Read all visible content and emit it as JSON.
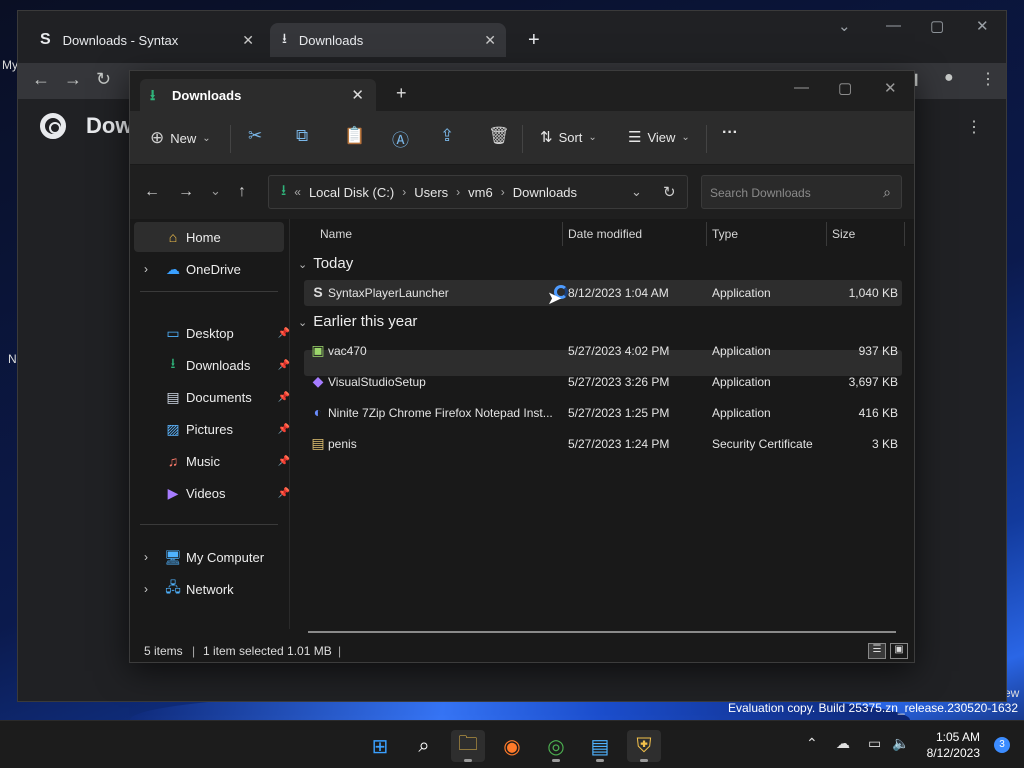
{
  "chrome": {
    "tabs": [
      {
        "label": "Downloads - Syntax",
        "icon_letter": "S"
      },
      {
        "label": "Downloads"
      }
    ],
    "page_title": "Dow",
    "left_fragment_my": "My",
    "left_fragment_n": "N"
  },
  "explorer": {
    "tab_title": "Downloads",
    "commands": {
      "new": "New",
      "sort": "Sort",
      "view": "View",
      "more": "···"
    },
    "breadcrumb": [
      "Local Disk (C:)",
      "Users",
      "vm6",
      "Downloads"
    ],
    "search_placeholder": "Search Downloads",
    "sidebar": {
      "home": "Home",
      "onedrive": "OneDrive",
      "pinned": [
        {
          "label": "Desktop",
          "icon": "desktop-icon"
        },
        {
          "label": "Downloads",
          "icon": "downloads-icon"
        },
        {
          "label": "Documents",
          "icon": "documents-icon"
        },
        {
          "label": "Pictures",
          "icon": "pictures-icon"
        },
        {
          "label": "Music",
          "icon": "music-icon"
        },
        {
          "label": "Videos",
          "icon": "videos-icon"
        }
      ],
      "my_computer": "My Computer",
      "network": "Network"
    },
    "columns": {
      "name": "Name",
      "date": "Date modified",
      "type": "Type",
      "size": "Size"
    },
    "groups": {
      "today": {
        "label": "Today",
        "files": [
          {
            "name": "SyntaxPlayerLauncher",
            "date": "8/12/2023 1:04 AM",
            "type": "Application",
            "size": "1,040 KB",
            "selected": true
          }
        ]
      },
      "earlier": {
        "label": "Earlier this year",
        "files": [
          {
            "name": "vac470",
            "date": "5/27/2023 4:02 PM",
            "type": "Application",
            "size": "937 KB"
          },
          {
            "name": "VisualStudioSetup",
            "date": "5/27/2023 3:26 PM",
            "type": "Application",
            "size": "3,697 KB"
          },
          {
            "name": "Ninite 7Zip Chrome Firefox Notepad Inst...",
            "date": "5/27/2023 1:25 PM",
            "type": "Application",
            "size": "416 KB"
          },
          {
            "name": "penis",
            "date": "5/27/2023 1:24 PM",
            "type": "Security Certificate",
            "size": "3 KB"
          }
        ]
      }
    },
    "status": {
      "items": "5 items",
      "selected": "1 item selected  1.01 MB"
    }
  },
  "desktop": {
    "eval_text": "Evaluation copy. Build 25375.zn_release.230520-1632",
    "edge_fragment": "ew"
  },
  "taskbar": {
    "time": "1:05 AM",
    "date": "8/12/2023",
    "notification_count": "3"
  }
}
